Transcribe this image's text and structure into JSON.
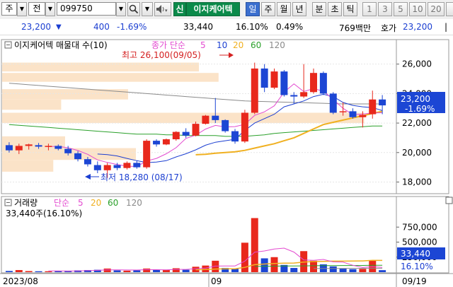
{
  "toolbar": {
    "market_label": "주",
    "code_label": "전",
    "code_value": "099750",
    "stock_name": "이지케어텍",
    "sig_label": "신",
    "periods": [
      "일",
      "주",
      "월",
      "년",
      "분",
      "초",
      "틱"
    ],
    "active_period": "일",
    "intervals": [
      "1",
      "3",
      "5",
      "10",
      "20"
    ]
  },
  "quote": {
    "price": "23,200",
    "change": "400",
    "change_pct": "-1.69%",
    "volume": "33,440",
    "volume_ratio": "16.10%",
    "turnover": "0.49%",
    "amount": "769백만",
    "ask_label": "호가",
    "ask_price": "23,200"
  },
  "colors": {
    "up": "#e8281c",
    "down": "#1c46d4",
    "ma5": "#e34bd0",
    "ma10": "#1c3fd1",
    "ma20": "#f0b020",
    "ma60": "#2aa02a",
    "ma120": "#8a8a8a",
    "volume_profile": "#fbe3c8"
  },
  "price_panel": {
    "title": "이지케어텍 매물대 수(10)",
    "legend": {
      "prefix": "종가 단순",
      "ma5": "5",
      "ma10": "10",
      "ma20": "20",
      "ma60": "60",
      "ma120": "120"
    },
    "high_annotation": "최고 26,100(09/05)",
    "low_annotation": "최저 18,280 (08/17)",
    "current_price": "23,200",
    "current_change": "-1.69%"
  },
  "volume_panel": {
    "legend": {
      "label": "거래량",
      "prefix": "단순",
      "ma5": "5",
      "ma20": "20",
      "ma60": "60",
      "ma120": "120"
    },
    "last_volume": "33,440주(16.10%)",
    "current_volume": "33,440",
    "current_ratio": "16.10%"
  },
  "x_axis": {
    "labels": [
      "2023/08",
      "09",
      "09/19"
    ]
  },
  "chart_data": {
    "type": "candlestick",
    "y_axis_price": {
      "ticks": [
        "26,000",
        "24,000",
        "22,000",
        "20,000",
        "18,000"
      ],
      "ylim": [
        17400,
        26800
      ]
    },
    "y_axis_volume": {
      "ticks": [
        "750,000",
        "500,000",
        "250,000"
      ],
      "ylim": [
        0,
        1000000
      ]
    },
    "candles": [
      {
        "o": 20500,
        "h": 20700,
        "l": 20000,
        "c": 20150
      },
      {
        "o": 20150,
        "h": 20600,
        "l": 19900,
        "c": 20450
      },
      {
        "o": 20450,
        "h": 20600,
        "l": 20200,
        "c": 20550
      },
      {
        "o": 20500,
        "h": 20650,
        "l": 20250,
        "c": 20400
      },
      {
        "o": 20400,
        "h": 20600,
        "l": 20150,
        "c": 20450
      },
      {
        "o": 20450,
        "h": 20550,
        "l": 20150,
        "c": 20250
      },
      {
        "o": 20250,
        "h": 20450,
        "l": 19800,
        "c": 19950
      },
      {
        "o": 19950,
        "h": 20100,
        "l": 19400,
        "c": 19550
      },
      {
        "o": 19550,
        "h": 19700,
        "l": 19050,
        "c": 19200
      },
      {
        "o": 19150,
        "h": 19400,
        "l": 18600,
        "c": 18800
      },
      {
        "o": 18800,
        "h": 19300,
        "l": 18280,
        "c": 19150
      },
      {
        "o": 19150,
        "h": 19300,
        "l": 18800,
        "c": 18950
      },
      {
        "o": 18950,
        "h": 19400,
        "l": 18850,
        "c": 19300
      },
      {
        "o": 19300,
        "h": 19450,
        "l": 18900,
        "c": 19000
      },
      {
        "o": 19000,
        "h": 20900,
        "l": 18900,
        "c": 20800
      },
      {
        "o": 20800,
        "h": 20900,
        "l": 20400,
        "c": 20550
      },
      {
        "o": 20550,
        "h": 20950,
        "l": 20500,
        "c": 20900
      },
      {
        "o": 20900,
        "h": 21450,
        "l": 20800,
        "c": 21400
      },
      {
        "o": 21400,
        "h": 21650,
        "l": 21000,
        "c": 21150
      },
      {
        "o": 21150,
        "h": 22100,
        "l": 21100,
        "c": 21950
      },
      {
        "o": 21950,
        "h": 22550,
        "l": 21900,
        "c": 22500
      },
      {
        "o": 22500,
        "h": 23700,
        "l": 22000,
        "c": 22200
      },
      {
        "o": 22200,
        "h": 22250,
        "l": 21350,
        "c": 21450
      },
      {
        "o": 21450,
        "h": 21600,
        "l": 20600,
        "c": 20750
      },
      {
        "o": 20750,
        "h": 22900,
        "l": 20650,
        "c": 22700
      },
      {
        "o": 22700,
        "h": 26100,
        "l": 22600,
        "c": 25700
      },
      {
        "o": 25700,
        "h": 26000,
        "l": 24100,
        "c": 24400
      },
      {
        "o": 24400,
        "h": 25700,
        "l": 24300,
        "c": 25500
      },
      {
        "o": 25500,
        "h": 25600,
        "l": 23800,
        "c": 23900
      },
      {
        "o": 23900,
        "h": 24100,
        "l": 23300,
        "c": 23800
      },
      {
        "o": 23800,
        "h": 26000,
        "l": 23700,
        "c": 24100
      },
      {
        "o": 24100,
        "h": 25700,
        "l": 24000,
        "c": 25400
      },
      {
        "o": 25400,
        "h": 25500,
        "l": 23900,
        "c": 24000
      },
      {
        "o": 24000,
        "h": 24100,
        "l": 22600,
        "c": 22700
      },
      {
        "o": 22800,
        "h": 23400,
        "l": 22500,
        "c": 22800
      },
      {
        "o": 22800,
        "h": 23000,
        "l": 22300,
        "c": 22400
      },
      {
        "o": 22400,
        "h": 22800,
        "l": 21700,
        "c": 22550
      },
      {
        "o": 22600,
        "h": 24200,
        "l": 22300,
        "c": 23600
      },
      {
        "o": 23600,
        "h": 23900,
        "l": 22600,
        "c": 23200
      }
    ],
    "volumes": [
      {
        "v": 20000,
        "up": false
      },
      {
        "v": 35000,
        "up": true
      },
      {
        "v": 18000,
        "up": true
      },
      {
        "v": 15000,
        "up": false
      },
      {
        "v": 15000,
        "up": true
      },
      {
        "v": 20000,
        "up": false
      },
      {
        "v": 25000,
        "up": false
      },
      {
        "v": 30000,
        "up": false
      },
      {
        "v": 35000,
        "up": false
      },
      {
        "v": 40000,
        "up": false
      },
      {
        "v": 60000,
        "up": true
      },
      {
        "v": 30000,
        "up": false
      },
      {
        "v": 25000,
        "up": true
      },
      {
        "v": 30000,
        "up": false
      },
      {
        "v": 60000,
        "up": true
      },
      {
        "v": 40000,
        "up": false
      },
      {
        "v": 35000,
        "up": true
      },
      {
        "v": 65000,
        "up": true
      },
      {
        "v": 40000,
        "up": false
      },
      {
        "v": 90000,
        "up": true
      },
      {
        "v": 110000,
        "up": true
      },
      {
        "v": 190000,
        "up": true
      },
      {
        "v": 70000,
        "up": false
      },
      {
        "v": 55000,
        "up": false
      },
      {
        "v": 490000,
        "up": true
      },
      {
        "v": 900000,
        "up": true
      },
      {
        "v": 230000,
        "up": false
      },
      {
        "v": 250000,
        "up": true
      },
      {
        "v": 120000,
        "up": false
      },
      {
        "v": 70000,
        "up": false
      },
      {
        "v": 350000,
        "up": true
      },
      {
        "v": 190000,
        "up": true
      },
      {
        "v": 130000,
        "up": false
      },
      {
        "v": 95000,
        "up": false
      },
      {
        "v": 60000,
        "up": false
      },
      {
        "v": 50000,
        "up": false
      },
      {
        "v": 55000,
        "up": true
      },
      {
        "v": 200000,
        "up": true
      },
      {
        "v": 33440,
        "up": false
      }
    ],
    "volume_profile": [
      {
        "low": 25500,
        "high": 26100,
        "rel": 0.5
      },
      {
        "low": 24800,
        "high": 25400,
        "rel": 0.55
      },
      {
        "low": 23600,
        "high": 24300,
        "rel": 0.32
      },
      {
        "low": 22900,
        "high": 23600,
        "rel": 0.15
      },
      {
        "low": 22000,
        "high": 22700,
        "rel": 0.92
      },
      {
        "low": 20300,
        "high": 21100,
        "rel": 0.16
      },
      {
        "low": 19500,
        "high": 20300,
        "rel": 0.34
      },
      {
        "low": 18700,
        "high": 19500,
        "rel": 0.13
      }
    ],
    "ma": {
      "ma5": [
        null,
        null,
        null,
        null,
        20400,
        20420,
        20320,
        20140,
        19880,
        19500,
        19330,
        19190,
        19080,
        19050,
        19430,
        19600,
        19920,
        20330,
        20960,
        21180,
        21590,
        21840,
        21740,
        21760,
        21920,
        22520,
        22760,
        23170,
        24100,
        24660,
        24140,
        24340,
        24160,
        23600,
        23000,
        22570,
        22610,
        22690,
        22700
      ],
      "ma10": [
        null,
        null,
        null,
        null,
        null,
        null,
        null,
        null,
        null,
        19900,
        19860,
        19770,
        19600,
        19450,
        19320,
        19350,
        19450,
        19700,
        19920,
        20180,
        20500,
        20700,
        20800,
        20900,
        21500,
        22000,
        22300,
        22600,
        23100,
        23300,
        23500,
        23800,
        23950,
        23800,
        23400,
        23200,
        23100,
        23050,
        22850
      ],
      "ma20": [
        null,
        null,
        null,
        null,
        null,
        null,
        null,
        null,
        null,
        null,
        null,
        null,
        null,
        null,
        null,
        null,
        null,
        null,
        null,
        19850,
        19880,
        19950,
        20000,
        20050,
        20150,
        20300,
        20450,
        20600,
        20800,
        21000,
        21300,
        21600,
        21900,
        22050,
        22200,
        22350,
        22500,
        22650,
        22800
      ],
      "ma60": [
        21900,
        21850,
        21800,
        21750,
        21700,
        21650,
        21600,
        21550,
        21500,
        21450,
        21400,
        21350,
        21300,
        21250,
        21250,
        21250,
        21200,
        21200,
        21150,
        21150,
        21150,
        21150,
        21100,
        21100,
        21100,
        21150,
        21200,
        21300,
        21350,
        21400,
        21450,
        21500,
        21550,
        21600,
        21650,
        21700,
        21750,
        21800,
        21800
      ],
      "ma120": [
        24700,
        24650,
        24600,
        24550,
        24500,
        24450,
        24400,
        24350,
        24300,
        24250,
        24200,
        24150,
        24100,
        24050,
        24000,
        23950,
        23900,
        23850,
        23800,
        23750,
        23700,
        23650,
        23600,
        23550,
        23500,
        23480,
        23460,
        23440,
        23420,
        23400,
        23380,
        23360,
        23340,
        23320,
        23300,
        23300,
        23300,
        23300,
        23300
      ]
    },
    "vol_ma": {
      "ma5": [
        null,
        null,
        null,
        null,
        20000,
        20000,
        18000,
        21000,
        25000,
        30000,
        38000,
        39000,
        36000,
        35000,
        41000,
        41000,
        38000,
        46000,
        46000,
        58000,
        68000,
        101000,
        103000,
        103000,
        183000,
        333000,
        353000,
        385000,
        400000,
        334000,
        204000,
        196000,
        212000,
        171000,
        167000,
        114000,
        78000,
        92000,
        80000
      ],
      "ma20": [
        null,
        null,
        null,
        null,
        null,
        null,
        null,
        null,
        null,
        null,
        null,
        null,
        null,
        null,
        null,
        null,
        null,
        null,
        null,
        40000,
        44000,
        52000,
        55000,
        57000,
        80000,
        125000,
        135000,
        145000,
        150000,
        152000,
        168000,
        176000,
        180000,
        183000,
        184000,
        186000,
        187000,
        196000,
        195000
      ],
      "ma60": [
        null,
        null,
        null,
        null,
        null,
        null,
        null,
        null,
        null,
        null,
        null,
        null,
        null,
        null,
        null,
        null,
        null,
        null,
        null,
        null,
        null,
        null,
        null,
        null,
        null,
        95000,
        98000,
        100000,
        102000,
        103000,
        105000,
        107000,
        108000,
        109000,
        110000,
        111000,
        112000,
        114000,
        115000
      ],
      "ma120": [
        null,
        null,
        null,
        null,
        null,
        null,
        null,
        null,
        null,
        null,
        null,
        null,
        null,
        null,
        null,
        null,
        null,
        null,
        null,
        null,
        null,
        null,
        null,
        null,
        null,
        null,
        null,
        null,
        null,
        null,
        null,
        60000,
        61000,
        62000,
        62000,
        63000,
        63000,
        64000,
        64000
      ]
    }
  }
}
